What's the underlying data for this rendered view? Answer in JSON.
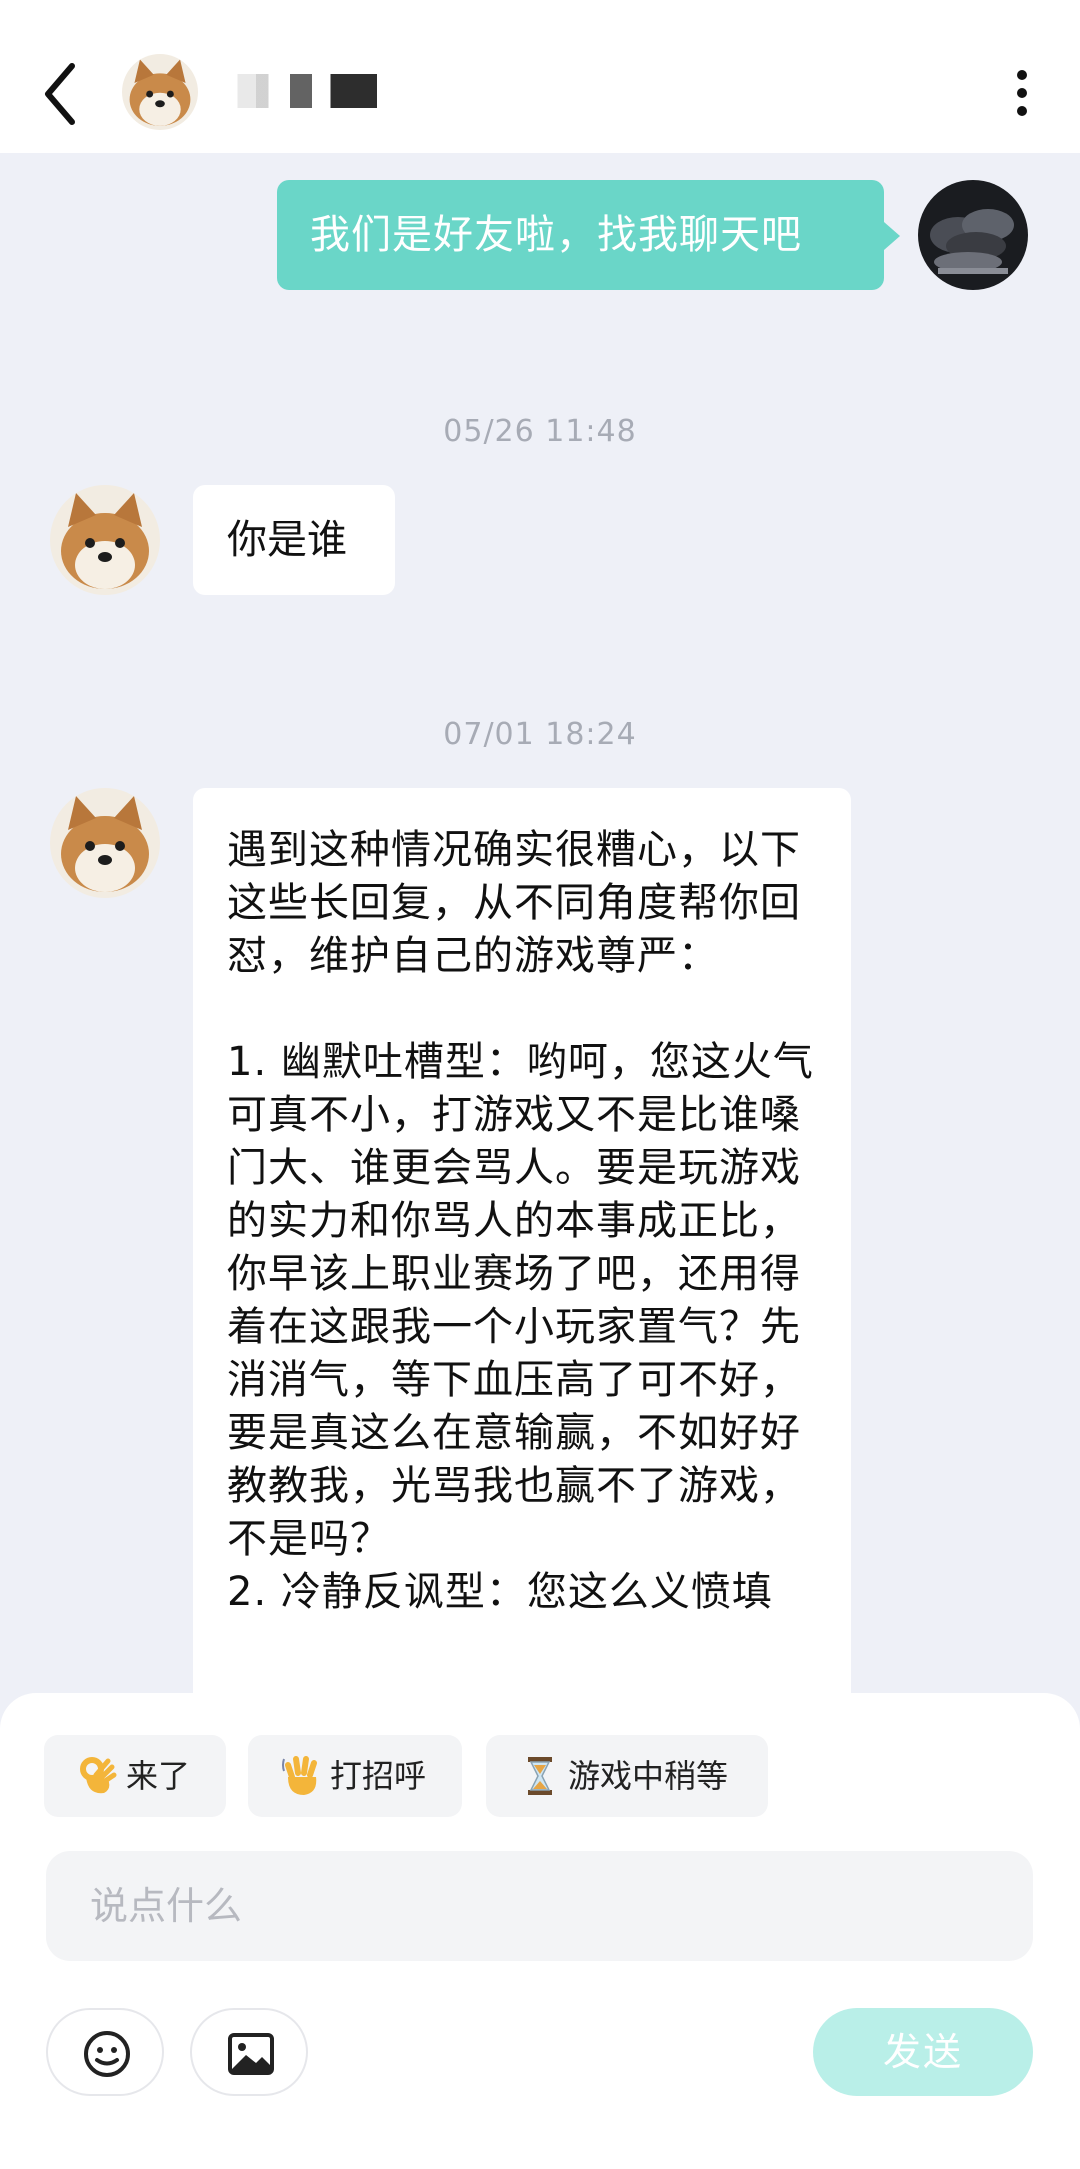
{
  "header": {
    "contact_name": "",
    "back_icon": "chevron-left-icon",
    "more_icon": "more-vertical-icon"
  },
  "messages": {
    "me_1": "我们是好友啦，找我聊天吧",
    "time_1": "05/26 11:48",
    "other_1": "你是谁",
    "time_2": "07/01 18:24",
    "other_2": "遇到这种情况确实很糟心，以下这些长回复，从不同角度帮你回怼，维护自己的游戏尊严：\n\n1. 幽默吐槽型：哟呵，您这火气可真不小，打游戏又不是比谁嗓门大、谁更会骂人。要是玩游戏的实力和你骂人的本事成正比，你早该上职业赛场了吧，还用得着在这跟我一个小玩家置气？先消消气，等下血压高了可不好，要是真这么在意输赢，不如好好教教我，光骂我也赢不了游戏，不是吗？\n2. 冷静反讽型：您这么义愤填"
  },
  "quick_replies": [
    {
      "icon": "ok-hand-icon",
      "label": "来了"
    },
    {
      "icon": "waving-hand-icon",
      "label": "打招呼"
    },
    {
      "icon": "hourglass-icon",
      "label": "游戏中稍等"
    }
  ],
  "input": {
    "placeholder": "说点什么",
    "value": ""
  },
  "toolbar": {
    "emoji_icon": "emoji-icon",
    "image_icon": "image-icon",
    "send_label": "发送"
  },
  "colors": {
    "my_bubble": "#6ad6c8",
    "send_button_disabled": "#b9efe8",
    "background": "#eef0f7"
  }
}
